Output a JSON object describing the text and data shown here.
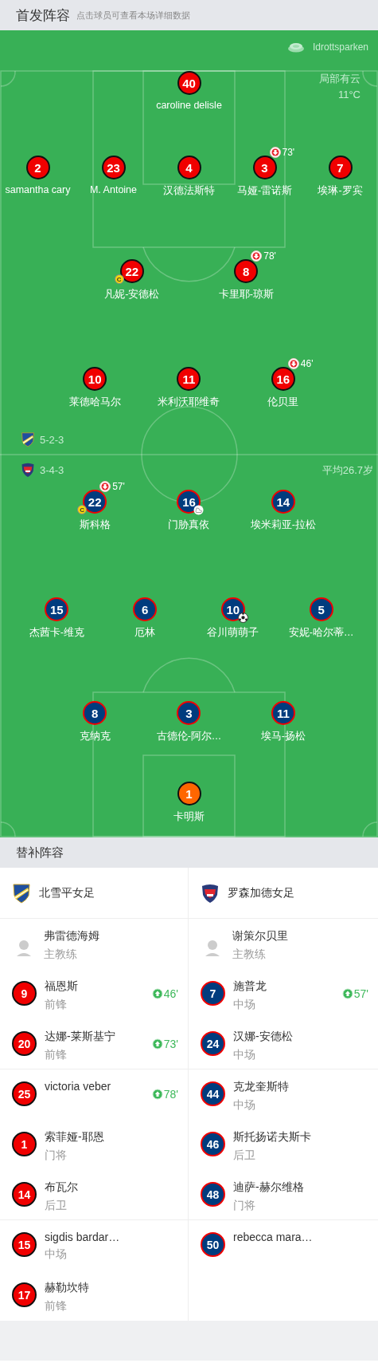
{
  "header": {
    "title": "首发阵容",
    "subtitle": "点击球员可查看本场详细数据"
  },
  "pitch": {
    "stadium": "Idrottsparken",
    "weather": "局部有云",
    "temperature": "11°C",
    "average_age": "平均26.7岁",
    "home": {
      "formation": "5-2-3",
      "color": "#f00000",
      "lines": [
        {
          "players": [
            {
              "number": "40",
              "name": "caroline delisle",
              "goal": false,
              "assist": false
            }
          ]
        },
        {
          "players": [
            {
              "number": "2",
              "name": "samantha cary",
              "goal": false,
              "assist": false
            },
            {
              "number": "23",
              "name": "M. Antoine",
              "goal": false,
              "assist": false
            },
            {
              "number": "4",
              "name": "汉德法斯特",
              "goal": false,
              "assist": false
            },
            {
              "number": "3",
              "name": "马娅-雷诺斯",
              "sub_off": "73'",
              "goal": false,
              "assist": false
            },
            {
              "number": "7",
              "name": "埃琳-罗宾",
              "goal": false,
              "assist": false
            }
          ]
        },
        {
          "players": [
            {
              "number": "22",
              "name": "凡妮-安德松",
              "captain": "C",
              "goal": false,
              "assist": false
            },
            {
              "number": "8",
              "name": "卡里耶-琼斯",
              "sub_off": "78'",
              "goal": false,
              "assist": false
            }
          ]
        },
        {
          "players": [
            {
              "number": "10",
              "name": "莱德哈马尔",
              "goal": false,
              "assist": false
            },
            {
              "number": "11",
              "name": "米利沃耶维奇",
              "goal": false,
              "assist": false
            },
            {
              "number": "16",
              "name": "伦贝里",
              "sub_off": "46'",
              "goal": false,
              "assist": false
            }
          ]
        }
      ]
    },
    "away": {
      "formation": "3-4-3",
      "color": "#003c7e",
      "lines": [
        {
          "players": [
            {
              "number": "22",
              "name": "斯科格",
              "sub_off": "57'",
              "captain": "C",
              "goal": false,
              "assist": false
            },
            {
              "number": "16",
              "name": "门胁真依",
              "goal": false,
              "assist": true
            },
            {
              "number": "14",
              "name": "埃米莉亚-拉松",
              "goal": false,
              "assist": false
            }
          ]
        },
        {
          "players": [
            {
              "number": "15",
              "name": "杰茜卡-维克",
              "goal": false,
              "assist": false
            },
            {
              "number": "6",
              "name": "厄林",
              "goal": false,
              "assist": false
            },
            {
              "number": "10",
              "name": "谷川萌萌子",
              "goal": true,
              "assist": false
            },
            {
              "number": "5",
              "name": "安妮-哈尔蒂…",
              "goal": false,
              "assist": false
            }
          ]
        },
        {
          "players": [
            {
              "number": "8",
              "name": "克纳克",
              "goal": false,
              "assist": false
            },
            {
              "number": "3",
              "name": "古德伦-阿尔…",
              "goal": false,
              "assist": false
            },
            {
              "number": "11",
              "name": "埃马-扬松",
              "goal": false,
              "assist": false
            }
          ]
        },
        {
          "players": [
            {
              "number": "1",
              "name": "卡明斯",
              "color": "#ff6600",
              "goal": false,
              "assist": false
            }
          ]
        }
      ]
    }
  },
  "subs": {
    "title": "替补阵容",
    "teams": [
      {
        "name": "北雪平女足",
        "coach": {
          "name": "弗雷德海姆",
          "role": "主教练"
        },
        "players": [
          {
            "number": "9",
            "name": "福恩斯",
            "position": "前锋",
            "sub_on": "46'"
          },
          {
            "number": "20",
            "name": "达娜-莱斯基宁",
            "position": "前锋",
            "sub_on": "73'"
          },
          {
            "number": "25",
            "name": "victoria veber",
            "sub_on": "78'"
          },
          {
            "number": "1",
            "name": "索菲娅-耶恩",
            "position": "门将"
          },
          {
            "number": "14",
            "name": "布瓦尔",
            "position": "后卫"
          },
          {
            "number": "15",
            "name": "sigdis bardar…",
            "position": "中场"
          },
          {
            "number": "17",
            "name": "赫勒坎特",
            "position": "前锋"
          }
        ]
      },
      {
        "name": "罗森加德女足",
        "coach": {
          "name": "谢策尔贝里",
          "role": "主教练"
        },
        "players": [
          {
            "number": "7",
            "name": "施普龙",
            "position": "中场",
            "sub_on": "57'"
          },
          {
            "number": "24",
            "name": "汉娜-安德松",
            "position": "中场"
          },
          {
            "number": "44",
            "name": "克龙奎斯特",
            "position": "中场"
          },
          {
            "number": "46",
            "name": "斯托扬诺夫斯卡",
            "position": "后卫"
          },
          {
            "number": "48",
            "name": "迪萨-赫尔维格",
            "position": "门将"
          },
          {
            "number": "50",
            "name": "rebecca mara…"
          }
        ]
      }
    ]
  }
}
